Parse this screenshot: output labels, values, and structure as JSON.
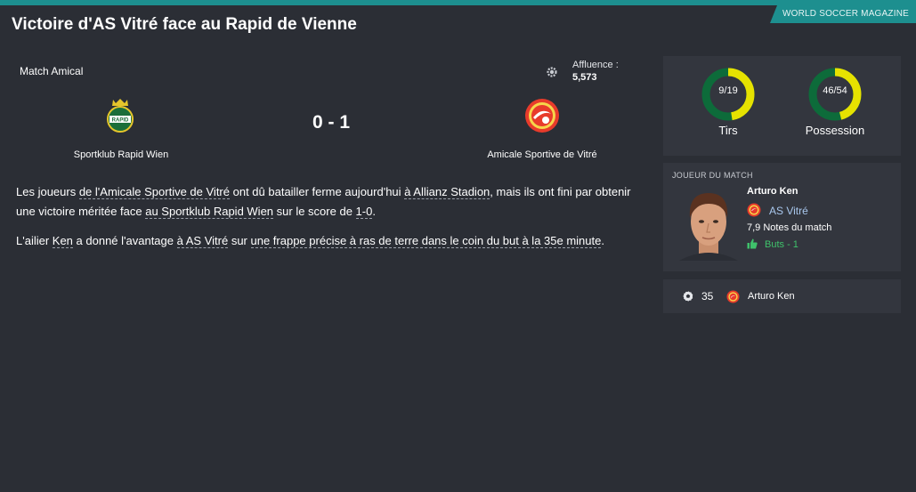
{
  "header": {
    "magazine": "WORLD SOCCER MAGAZINE",
    "headline": "Victoire d'AS Vitré face au Rapid de Vienne"
  },
  "match": {
    "type": "Match Amical",
    "attendance_label": "Affluence :",
    "attendance_value": "5,573",
    "score": "0 - 1",
    "home_team": "Sportklub Rapid Wien",
    "away_team": "Amicale Sportive de Vitré",
    "home_crest_text": "RAPID"
  },
  "article": {
    "p1": {
      "t1": "Les joueurs ",
      "l1": "de l'Amicale Sportive de Vitré",
      "t2": " ont dû batailler ferme aujourd'hui ",
      "l2": "à Allianz Stadion",
      "t3": ", mais ils ont fini par obtenir une victoire méritée face ",
      "l3": "au Sportklub Rapid Wien",
      "t4": " sur le score de ",
      "l4": "1-0",
      "t5": "."
    },
    "p2": {
      "t1": "L'ailier ",
      "l1": "Ken",
      "t2": " a donné l'avantage ",
      "l2": "à AS Vitré",
      "t3": " sur ",
      "l3": "une frappe précise à ras de terre dans le coin du but à la 35e minute",
      "t4": "."
    }
  },
  "stats": {
    "shots": {
      "value": "9/19",
      "label": "Tirs",
      "fraction": 0.474
    },
    "possession": {
      "value": "46/54",
      "label": "Possession",
      "fraction": 0.46
    },
    "colors": {
      "home": "#e6e200",
      "away": "#0d6b3a"
    }
  },
  "player_of_match": {
    "title": "JOUEUR DU MATCH",
    "name": "Arturo Ken",
    "club": "AS Vitré",
    "rating": "7,9 Notes du match",
    "goals": "Buts - 1"
  },
  "goal_event": {
    "minute": "35",
    "scorer": "Arturo Ken"
  }
}
